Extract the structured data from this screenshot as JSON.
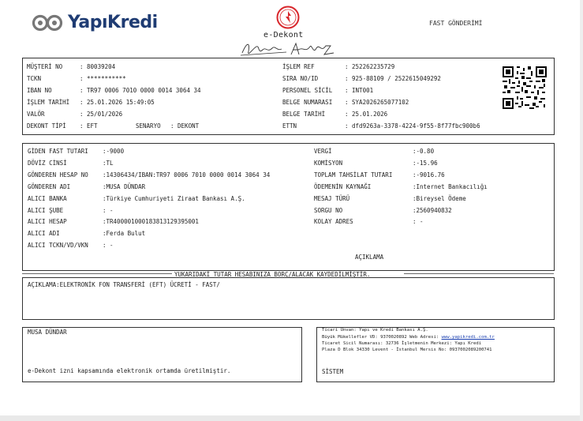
{
  "header": {
    "brand": "YapıKredi",
    "doc_title": "e-Dekont",
    "form_title": "FAST GÖNDERİMİ"
  },
  "top": {
    "rows_left": [
      {
        "label": "MÜŞTERİ NO",
        "value": ": 80039204"
      },
      {
        "label": "TCKN",
        "value": ": ***********"
      },
      {
        "label": "IBAN NO",
        "value": ": TR97 0006 7010 0000 0014 3064 34"
      },
      {
        "label": "İŞLEM TARİHİ",
        "value": ": 25.01.2026 15:49:05"
      },
      {
        "label": "VALÖR",
        "value": ": 25/01/2026"
      },
      {
        "label": "DEKONT TİPİ",
        "value": ": EFT"
      }
    ],
    "senaryo_label": "SENARYO",
    "senaryo_value": ": DEKONT",
    "rows_right": [
      {
        "label": "İŞLEM REF",
        "value": ": 252262235729"
      },
      {
        "label": "SIRA NO/ID",
        "value": ": 925-88109 / 2522615049292"
      },
      {
        "label": "PERSONEL SİCİL",
        "value": ": INT001"
      },
      {
        "label": "BELGE NUMARASI",
        "value": ": SYA2026265077102"
      },
      {
        "label": "BELGE TARİHİ",
        "value": ": 25.01.2026"
      },
      {
        "label": "ETTN",
        "value": ": dfd9263a-3378-4224-9f55-8f77fbc900b6"
      }
    ]
  },
  "details": {
    "rows_left": [
      {
        "label": "GİDEN FAST TUTARI",
        "value": ":-9000"
      },
      {
        "label": "DÖVİZ CİNSİ",
        "value": ":TL"
      },
      {
        "label": "GÖNDEREN HESAP NO",
        "value": ":14306434/IBAN:TR97 0006 7010 0000 0014 3064 34"
      },
      {
        "label": "GÖNDEREN ADI",
        "value": ":MUSA DÜNDAR"
      },
      {
        "label": "ALICI BANKA",
        "value": ":Türkiye Cumhuriyeti Ziraat Bankası A.Ş."
      },
      {
        "label": "ALICI ŞUBE",
        "value": ": -"
      },
      {
        "label": "ALICI HESAP",
        "value": ":TR400001000183813129395001"
      },
      {
        "label": "ALICI ADI",
        "value": ":Ferda Bulut"
      },
      {
        "label": "ALICI TCKN/VD/VKN",
        "value": ": -"
      }
    ],
    "rows_right": [
      {
        "label": "VERGİ",
        "value": ":-0.80"
      },
      {
        "label": "KOMİSYON",
        "value": ":-15.96"
      },
      {
        "label": "TOPLAM TAHSİLAT TUTARI",
        "value": ":-9016.76"
      },
      {
        "label": "ÖDEMENİN KAYNAĞI",
        "value": ":Internet Bankacılığı"
      },
      {
        "label": "MESAJ TÜRÜ",
        "value": ":Bireysel Ödeme"
      },
      {
        "label": "SORGU NO",
        "value": ":2560940832"
      },
      {
        "label": "KOLAY ADRES",
        "value": ": -"
      }
    ],
    "aciklama_header": "AÇIKLAMA"
  },
  "caption": "YUKARIDAKİ TUTAR HESABINIZA BORÇ/ALACAK KAYDEDİLMİŞTİR.",
  "description": "AÇIKLAMA:ELEKTRONİK FON TRANSFERİ (EFT) ÜCRETİ - FAST/",
  "footer": {
    "customer_name": "MUSA DÜNDAR",
    "legal_note": "e-Dekont izni kapsamında elektronik ortamda üretilmiştir.",
    "bank_line1": "Ticari Unvan: Yapı ve Kredi Bankası A.Ş.",
    "bank_line2_prefix": "Büyük Mükellefler VD: 9370020892 Web Adresi: ",
    "bank_web": "www.yapikredi.com.tr",
    "bank_line3": "Ticaret Sicil Numarası: 32736 İşletmenin Merkezi: Yapı Kredi",
    "bank_line4": "Plaza D Blok 34330 Levent - İstanbul Mersis No: 0937002089200741",
    "system": "SİSTEM"
  },
  "colors": {
    "brand_blue": "#1f3c73",
    "emblem_red": "#d8262b",
    "link_blue": "#1a3fb0"
  }
}
